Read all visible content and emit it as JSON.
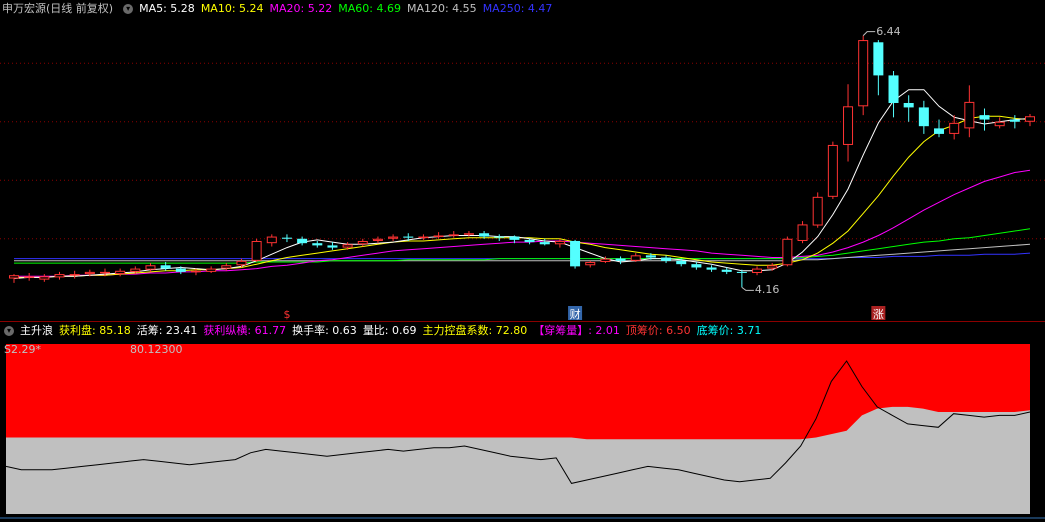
{
  "main_panel": {
    "title": "申万宏源(日线 前复权)",
    "indicators": [
      {
        "label": "MA5: 5.28",
        "color": "#ffffff"
      },
      {
        "label": "MA10: 5.24",
        "color": "#ffff00"
      },
      {
        "label": "MA20: 5.22",
        "color": "#ff00ff"
      },
      {
        "label": "MA60: 4.69",
        "color": "#00ff00"
      },
      {
        "label": "MA120: 4.55",
        "color": "#c0c0c0"
      },
      {
        "label": "MA250: 4.47",
        "color": "#3333ff"
      }
    ],
    "high_label": "6.44",
    "low_label": "4.16",
    "event_markers": [
      {
        "text": "$",
        "color": "#ff3333"
      },
      {
        "text": "财",
        "color": "#ffffff",
        "bg": "#3366aa"
      },
      {
        "text": "涨",
        "color": "#ffffff",
        "bg": "#aa2222"
      }
    ],
    "colors": {
      "up": "#ff3333",
      "down": "#54ffff"
    }
  },
  "sub_panel": {
    "title": "主升浪",
    "indicators": [
      {
        "label": "获利盘: 85.18",
        "color": "#ffff00"
      },
      {
        "label": "活筹: 23.41",
        "color": "#ffffff"
      },
      {
        "label": "获利纵横: 61.77",
        "color": "#ff00ff"
      },
      {
        "label": "换手率: 0.63",
        "color": "#ffffff"
      },
      {
        "label": "量比: 0.69",
        "color": "#ffffff"
      },
      {
        "label": "主力控盘系数: 72.80",
        "color": "#ffff00"
      },
      {
        "label": "【穿筹量】: 2.01",
        "color": "#ff00ff"
      },
      {
        "label": "顶筹价: 6.50",
        "color": "#ff3333"
      },
      {
        "label": "底筹价: 3.71",
        "color": "#00ffff"
      }
    ],
    "left_value": "S2.29*",
    "mid_value": "80.12300",
    "colors": {
      "top_fill": "#ff0000",
      "bottom_fill": "#c0c0c0"
    }
  },
  "chart_data": {
    "type": "candlestick",
    "ylim": [
      4.0,
      6.6
    ],
    "high_marker": 6.44,
    "low_marker": 4.16,
    "candles": [
      [
        4.24,
        4.27,
        4.2,
        4.28
      ],
      [
        4.25,
        4.26,
        4.22,
        4.29
      ],
      [
        4.23,
        4.26,
        4.21,
        4.28
      ],
      [
        4.25,
        4.28,
        4.23,
        4.3
      ],
      [
        4.27,
        4.28,
        4.24,
        4.31
      ],
      [
        4.28,
        4.3,
        4.26,
        4.32
      ],
      [
        4.29,
        4.3,
        4.26,
        4.33
      ],
      [
        4.28,
        4.31,
        4.26,
        4.33
      ],
      [
        4.3,
        4.33,
        4.28,
        4.35
      ],
      [
        4.32,
        4.36,
        4.3,
        4.38
      ],
      [
        4.36,
        4.33,
        4.31,
        4.39
      ],
      [
        4.33,
        4.3,
        4.28,
        4.35
      ],
      [
        4.3,
        4.31,
        4.27,
        4.33
      ],
      [
        4.3,
        4.33,
        4.29,
        4.35
      ],
      [
        4.33,
        4.36,
        4.31,
        4.38
      ],
      [
        4.36,
        4.4,
        4.34,
        4.42
      ],
      [
        4.4,
        4.58,
        4.39,
        4.6
      ],
      [
        4.56,
        4.62,
        4.53,
        4.64
      ],
      [
        4.61,
        4.6,
        4.57,
        4.64
      ],
      [
        4.6,
        4.56,
        4.54,
        4.62
      ],
      [
        4.56,
        4.54,
        4.52,
        4.58
      ],
      [
        4.54,
        4.52,
        4.5,
        4.57
      ],
      [
        4.52,
        4.55,
        4.5,
        4.57
      ],
      [
        4.55,
        4.58,
        4.53,
        4.6
      ],
      [
        4.58,
        4.6,
        4.56,
        4.62
      ],
      [
        4.6,
        4.62,
        4.58,
        4.64
      ],
      [
        4.62,
        4.61,
        4.58,
        4.65
      ],
      [
        4.61,
        4.62,
        4.59,
        4.64
      ],
      [
        4.62,
        4.63,
        4.6,
        4.66
      ],
      [
        4.63,
        4.64,
        4.61,
        4.67
      ],
      [
        4.64,
        4.65,
        4.62,
        4.67
      ],
      [
        4.65,
        4.62,
        4.6,
        4.67
      ],
      [
        4.62,
        4.61,
        4.58,
        4.64
      ],
      [
        4.62,
        4.59,
        4.56,
        4.63
      ],
      [
        4.59,
        4.57,
        4.55,
        4.6
      ],
      [
        4.57,
        4.55,
        4.54,
        4.6
      ],
      [
        4.55,
        4.58,
        4.52,
        4.6
      ],
      [
        4.58,
        4.35,
        4.33,
        4.59
      ],
      [
        4.36,
        4.39,
        4.34,
        4.4
      ],
      [
        4.39,
        4.42,
        4.38,
        4.44
      ],
      [
        4.42,
        4.4,
        4.37,
        4.44
      ],
      [
        4.4,
        4.45,
        4.39,
        4.47
      ],
      [
        4.45,
        4.43,
        4.41,
        4.47
      ],
      [
        4.43,
        4.4,
        4.38,
        4.45
      ],
      [
        4.4,
        4.37,
        4.35,
        4.42
      ],
      [
        4.37,
        4.34,
        4.32,
        4.39
      ],
      [
        4.34,
        4.32,
        4.3,
        4.36
      ],
      [
        4.32,
        4.3,
        4.28,
        4.34
      ],
      [
        4.3,
        4.29,
        4.16,
        4.32
      ],
      [
        4.29,
        4.33,
        4.27,
        4.35
      ],
      [
        4.33,
        4.36,
        4.31,
        4.38
      ],
      [
        4.36,
        4.6,
        4.35,
        4.62
      ],
      [
        4.58,
        4.73,
        4.56,
        4.76
      ],
      [
        4.72,
        4.98,
        4.7,
        5.02
      ],
      [
        4.98,
        5.45,
        4.96,
        5.48
      ],
      [
        5.45,
        5.8,
        5.3,
        6.0
      ],
      [
        5.8,
        6.4,
        5.72,
        6.44
      ],
      [
        6.38,
        6.08,
        5.9,
        6.4
      ],
      [
        6.08,
        5.83,
        5.7,
        6.12
      ],
      [
        5.83,
        5.79,
        5.66,
        5.9
      ],
      [
        5.79,
        5.62,
        5.55,
        5.85
      ],
      [
        5.6,
        5.55,
        5.52,
        5.68
      ],
      [
        5.55,
        5.65,
        5.5,
        5.72
      ],
      [
        5.6,
        5.84,
        5.52,
        5.99
      ],
      [
        5.72,
        5.68,
        5.58,
        5.78
      ],
      [
        5.62,
        5.66,
        5.6,
        5.7
      ],
      [
        5.68,
        5.66,
        5.6,
        5.72
      ],
      [
        5.66,
        5.71,
        5.62,
        5.73
      ]
    ],
    "ma5": [
      4.24,
      4.25,
      4.25,
      4.26,
      4.26,
      4.27,
      4.28,
      4.29,
      4.3,
      4.32,
      4.33,
      4.34,
      4.33,
      4.32,
      4.33,
      4.35,
      4.4,
      4.46,
      4.52,
      4.57,
      4.59,
      4.57,
      4.55,
      4.55,
      4.56,
      4.57,
      4.59,
      4.61,
      4.62,
      4.63,
      4.63,
      4.63,
      4.62,
      4.62,
      4.6,
      4.58,
      4.57,
      4.52,
      4.47,
      4.42,
      4.39,
      4.4,
      4.42,
      4.42,
      4.41,
      4.39,
      4.37,
      4.34,
      4.31,
      4.31,
      4.32,
      4.38,
      4.48,
      4.62,
      4.82,
      5.05,
      5.36,
      5.65,
      5.85,
      5.95,
      5.95,
      5.8,
      5.7,
      5.67,
      5.64,
      5.66,
      5.68,
      5.69
    ],
    "ma10": [
      4.25,
      4.25,
      4.25,
      4.26,
      4.26,
      4.27,
      4.27,
      4.28,
      4.29,
      4.3,
      4.31,
      4.31,
      4.32,
      4.32,
      4.33,
      4.34,
      4.37,
      4.4,
      4.43,
      4.45,
      4.47,
      4.49,
      4.51,
      4.53,
      4.55,
      4.57,
      4.58,
      4.58,
      4.59,
      4.6,
      4.61,
      4.61,
      4.61,
      4.61,
      4.61,
      4.6,
      4.6,
      4.57,
      4.55,
      4.52,
      4.5,
      4.48,
      4.46,
      4.45,
      4.43,
      4.41,
      4.39,
      4.38,
      4.37,
      4.36,
      4.36,
      4.38,
      4.41,
      4.47,
      4.56,
      4.67,
      4.83,
      4.99,
      5.17,
      5.34,
      5.48,
      5.58,
      5.63,
      5.69,
      5.71,
      5.71,
      5.69,
      5.68
    ],
    "ma20": [
      4.26,
      4.26,
      4.26,
      4.26,
      4.27,
      4.27,
      4.27,
      4.28,
      4.28,
      4.29,
      4.29,
      4.3,
      4.3,
      4.31,
      4.31,
      4.32,
      4.33,
      4.35,
      4.36,
      4.38,
      4.4,
      4.41,
      4.43,
      4.45,
      4.47,
      4.49,
      4.5,
      4.51,
      4.52,
      4.53,
      4.54,
      4.55,
      4.56,
      4.57,
      4.57,
      4.58,
      4.58,
      4.57,
      4.56,
      4.55,
      4.54,
      4.53,
      4.52,
      4.51,
      4.5,
      4.49,
      4.47,
      4.46,
      4.45,
      4.44,
      4.43,
      4.43,
      4.44,
      4.45,
      4.48,
      4.52,
      4.57,
      4.63,
      4.7,
      4.78,
      4.86,
      4.93,
      5.0,
      5.06,
      5.12,
      5.16,
      5.2,
      5.22
    ],
    "ma60": [
      4.38,
      4.38,
      4.38,
      4.38,
      4.38,
      4.38,
      4.38,
      4.38,
      4.38,
      4.38,
      4.38,
      4.38,
      4.38,
      4.38,
      4.38,
      4.38,
      4.39,
      4.39,
      4.39,
      4.39,
      4.39,
      4.4,
      4.4,
      4.4,
      4.4,
      4.4,
      4.41,
      4.41,
      4.41,
      4.41,
      4.41,
      4.41,
      4.42,
      4.42,
      4.42,
      4.42,
      4.42,
      4.42,
      4.42,
      4.42,
      4.42,
      4.42,
      4.42,
      4.42,
      4.42,
      4.42,
      4.42,
      4.42,
      4.42,
      4.42,
      4.42,
      4.42,
      4.43,
      4.44,
      4.45,
      4.47,
      4.49,
      4.51,
      4.53,
      4.55,
      4.57,
      4.58,
      4.6,
      4.61,
      4.63,
      4.65,
      4.67,
      4.69
    ],
    "ma120": [
      4.4,
      4.4,
      4.4,
      4.4,
      4.4,
      4.4,
      4.4,
      4.4,
      4.4,
      4.4,
      4.4,
      4.4,
      4.4,
      4.4,
      4.4,
      4.4,
      4.4,
      4.4,
      4.4,
      4.4,
      4.4,
      4.4,
      4.4,
      4.4,
      4.4,
      4.4,
      4.4,
      4.4,
      4.4,
      4.4,
      4.4,
      4.4,
      4.4,
      4.4,
      4.4,
      4.4,
      4.4,
      4.4,
      4.4,
      4.4,
      4.4,
      4.4,
      4.4,
      4.4,
      4.4,
      4.4,
      4.4,
      4.4,
      4.4,
      4.4,
      4.4,
      4.4,
      4.41,
      4.41,
      4.42,
      4.43,
      4.44,
      4.45,
      4.46,
      4.47,
      4.48,
      4.49,
      4.5,
      4.51,
      4.52,
      4.53,
      4.54,
      4.55
    ],
    "ma250": [
      4.42,
      4.42,
      4.42,
      4.42,
      4.42,
      4.42,
      4.42,
      4.42,
      4.42,
      4.42,
      4.42,
      4.42,
      4.42,
      4.42,
      4.42,
      4.42,
      4.42,
      4.42,
      4.42,
      4.42,
      4.42,
      4.42,
      4.42,
      4.42,
      4.42,
      4.42,
      4.42,
      4.42,
      4.42,
      4.42,
      4.42,
      4.42,
      4.42,
      4.42,
      4.42,
      4.42,
      4.42,
      4.42,
      4.42,
      4.42,
      4.42,
      4.42,
      4.42,
      4.42,
      4.42,
      4.42,
      4.42,
      4.42,
      4.42,
      4.42,
      4.42,
      4.42,
      4.42,
      4.42,
      4.42,
      4.43,
      4.43,
      4.43,
      4.44,
      4.44,
      4.44,
      4.45,
      4.45,
      4.45,
      4.46,
      4.46,
      4.46,
      4.47
    ],
    "sub_ylim": [
      0,
      100
    ],
    "sub_boundary": [
      45,
      45,
      45,
      45,
      45,
      45,
      45,
      45,
      45,
      45,
      45,
      45,
      45,
      45,
      45,
      45,
      45,
      45,
      45,
      45,
      45,
      45,
      45,
      45,
      45,
      45,
      45,
      45,
      45,
      45,
      45,
      45,
      45,
      45,
      45,
      45,
      45,
      45,
      44,
      44,
      44,
      44,
      44,
      44,
      44,
      44,
      44,
      44,
      44,
      44,
      44,
      44,
      44,
      45,
      47,
      49,
      58,
      62,
      63,
      63,
      62,
      60,
      60,
      60,
      60,
      60,
      60,
      61
    ],
    "sub_line": [
      28,
      26,
      26,
      26,
      27,
      28,
      29,
      30,
      31,
      32,
      31,
      30,
      29,
      30,
      31,
      32,
      36,
      38,
      37,
      36,
      35,
      34,
      35,
      36,
      37,
      38,
      37,
      38,
      39,
      39,
      40,
      38,
      36,
      34,
      33,
      32,
      33,
      18,
      20,
      22,
      24,
      26,
      28,
      27,
      26,
      24,
      22,
      20,
      19,
      20,
      21,
      30,
      40,
      56,
      78,
      90,
      75,
      63,
      58,
      53,
      52,
      51,
      59,
      58,
      57,
      58,
      58,
      60
    ]
  }
}
